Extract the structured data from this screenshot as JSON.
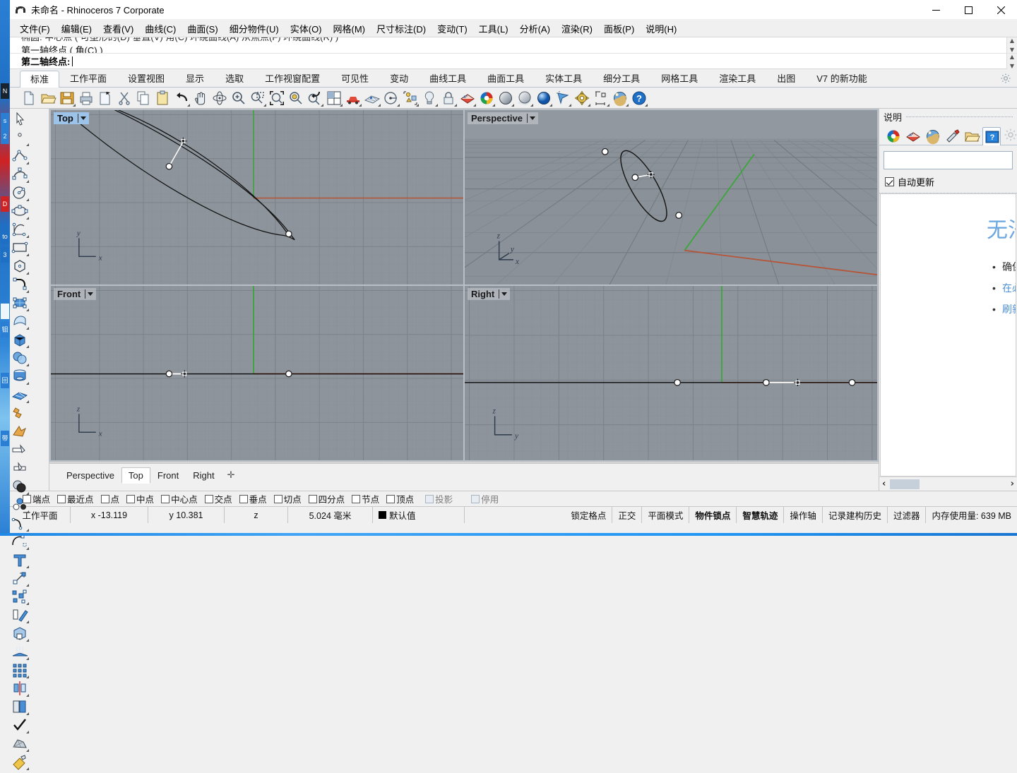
{
  "window": {
    "title": "未命名 - Rhinoceros 7 Corporate",
    "app_icon": "rhino-icon",
    "minimize_label": "—",
    "maximize_label": "☐",
    "close_label": "✕"
  },
  "menu": {
    "items": [
      {
        "label": "文件(F)"
      },
      {
        "label": "编辑(E)"
      },
      {
        "label": "查看(V)"
      },
      {
        "label": "曲线(C)"
      },
      {
        "label": "曲面(S)"
      },
      {
        "label": "细分物件(U)"
      },
      {
        "label": "实体(O)"
      },
      {
        "label": "网格(M)"
      },
      {
        "label": "尺寸标注(D)"
      },
      {
        "label": "变动(T)"
      },
      {
        "label": "工具(L)"
      },
      {
        "label": "分析(A)"
      },
      {
        "label": "渲染(R)"
      },
      {
        "label": "面板(P)"
      },
      {
        "label": "说明(H)"
      }
    ]
  },
  "command": {
    "history_line_cut": "椭圆: 中心点 ( 可塑形的(D) 垂直(V) 角(C) 环绕曲线(A) 从焦点(F) 环绕曲线(R) )",
    "history_line": "第一轴终点 ( 角(C) )",
    "prompt": "第二轴终点:",
    "input_value": ""
  },
  "toolbar_tabs": {
    "items": [
      {
        "label": "标准",
        "active": true
      },
      {
        "label": "工作平面",
        "active": false
      },
      {
        "label": "设置视图",
        "active": false
      },
      {
        "label": "显示",
        "active": false
      },
      {
        "label": "选取",
        "active": false
      },
      {
        "label": "工作视窗配置",
        "active": false
      },
      {
        "label": "可见性",
        "active": false
      },
      {
        "label": "变动",
        "active": false
      },
      {
        "label": "曲线工具",
        "active": false
      },
      {
        "label": "曲面工具",
        "active": false
      },
      {
        "label": "实体工具",
        "active": false
      },
      {
        "label": "细分工具",
        "active": false
      },
      {
        "label": "网格工具",
        "active": false
      },
      {
        "label": "渲染工具",
        "active": false
      },
      {
        "label": "出图",
        "active": false
      },
      {
        "label": "V7 的新功能",
        "active": false
      }
    ],
    "settings_icon": "gear-icon"
  },
  "main_toolbar": {
    "icons": [
      {
        "name": "new-file-icon",
        "flyout": false
      },
      {
        "name": "open-file-icon",
        "flyout": false
      },
      {
        "name": "save-file-icon",
        "flyout": true
      },
      {
        "name": "print-icon",
        "flyout": false
      },
      {
        "name": "export-icon",
        "flyout": false
      },
      {
        "name": "cut-icon",
        "flyout": false
      },
      {
        "name": "copy-icon",
        "flyout": false
      },
      {
        "name": "paste-icon",
        "flyout": false
      },
      {
        "name": "undo-icon",
        "flyout": true
      },
      {
        "name": "pan-icon",
        "flyout": false
      },
      {
        "name": "rotate-view-icon",
        "flyout": false
      },
      {
        "name": "zoom-in-icon",
        "flyout": false
      },
      {
        "name": "zoom-window-icon",
        "flyout": true
      },
      {
        "name": "zoom-extents-icon",
        "flyout": false
      },
      {
        "name": "zoom-selected-icon",
        "flyout": false
      },
      {
        "name": "zoom-previous-icon",
        "flyout": true
      },
      {
        "name": "viewport-layout-icon",
        "flyout": true
      },
      {
        "name": "render-preview-icon",
        "flyout": true
      },
      {
        "name": "grid-snap-icon",
        "flyout": true
      },
      {
        "name": "planar-icon",
        "flyout": true
      },
      {
        "name": "osnap-icon",
        "flyout": true
      },
      {
        "name": "light-icon",
        "flyout": true
      },
      {
        "name": "lock-icon",
        "flyout": true
      },
      {
        "name": "layer-icon",
        "flyout": true
      },
      {
        "name": "color-wheel-icon",
        "flyout": true
      },
      {
        "name": "shaded-view-icon",
        "flyout": true
      },
      {
        "name": "ghosted-view-icon",
        "flyout": true
      },
      {
        "name": "rendered-view-icon",
        "flyout": true
      },
      {
        "name": "select-filter-icon",
        "flyout": true
      },
      {
        "name": "options-gear-icon",
        "flyout": true
      },
      {
        "name": "dimension-icon",
        "flyout": true
      },
      {
        "name": "environment-icon",
        "flyout": true
      },
      {
        "name": "help-icon",
        "flyout": true
      }
    ]
  },
  "left_toolbar": {
    "icons": [
      {
        "name": "select-arrow-icon"
      },
      {
        "name": "point-icon"
      },
      {
        "name": "polyline-icon"
      },
      {
        "name": "control-point-curve-icon"
      },
      {
        "name": "circle-icon"
      },
      {
        "name": "ellipse-icon"
      },
      {
        "name": "arc-icon"
      },
      {
        "name": "rectangle-icon"
      },
      {
        "name": "polygon-icon"
      },
      {
        "name": "fillet-curve-icon"
      },
      {
        "name": "surface-from-points-icon"
      },
      {
        "name": "loft-surface-icon"
      },
      {
        "name": "box-icon"
      },
      {
        "name": "sphere-boolean-icon"
      },
      {
        "name": "cylinder-icon"
      },
      {
        "name": "surface-array-icon"
      },
      {
        "name": "explode-icon"
      },
      {
        "name": "join-icon"
      },
      {
        "name": "trim-icon"
      },
      {
        "name": "split-icon"
      },
      {
        "name": "boolean-union-icon"
      },
      {
        "name": "boolean-difference-icon"
      },
      {
        "name": "offset-curve-icon"
      },
      {
        "name": "blend-curve-icon"
      },
      {
        "name": "text-icon"
      },
      {
        "name": "point-transform-icon"
      },
      {
        "name": "scatter-copy-icon"
      },
      {
        "name": "move-icon"
      },
      {
        "name": "cube-boolean-icon"
      },
      {
        "name": "extrude-icon"
      },
      {
        "name": "array-icon"
      },
      {
        "name": "mirror-icon"
      },
      {
        "name": "properties-icon"
      },
      {
        "name": "check-icon"
      },
      {
        "name": "mesh-icon"
      },
      {
        "name": "render-paint-icon"
      }
    ]
  },
  "viewports": [
    {
      "name": "Top",
      "active": true,
      "axis_labels": [
        "y",
        "x"
      ]
    },
    {
      "name": "Perspective",
      "active": false,
      "axis_labels": [
        "z",
        "y",
        "x"
      ]
    },
    {
      "name": "Front",
      "active": false,
      "axis_labels": [
        "z",
        "x"
      ]
    },
    {
      "name": "Right",
      "active": false,
      "axis_labels": [
        "z",
        "y"
      ]
    }
  ],
  "viewport_tabs": {
    "items": [
      {
        "label": "Perspective",
        "active": false
      },
      {
        "label": "Top",
        "active": true
      },
      {
        "label": "Front",
        "active": false
      },
      {
        "label": "Right",
        "active": false
      }
    ],
    "add_label": "✛"
  },
  "right_panel": {
    "title": "说明",
    "tabs": [
      {
        "name": "layers-color-icon",
        "active": false
      },
      {
        "name": "materials-icon",
        "active": false
      },
      {
        "name": "environment-icon",
        "active": false
      },
      {
        "name": "ground-plane-icon",
        "active": false
      },
      {
        "name": "folder-icon",
        "active": false
      },
      {
        "name": "help-panel-icon",
        "active": true
      }
    ],
    "settings_icon": "gear-icon",
    "search_value": "",
    "search_placeholder": "",
    "autoupdate_label": "自动更新",
    "doc_heading": "无法显示说明内容",
    "doc_items": [
      {
        "text": "确保您的计算机已连接至网络。",
        "style": "dark"
      },
      {
        "text": "在必要时请检查防火墙设置。",
        "style": "link"
      },
      {
        "text": "刷新此页面重新载入内容。",
        "style": "link"
      }
    ],
    "scroll_left": "‹",
    "scroll_right": "›"
  },
  "osnap_bar": {
    "items": [
      {
        "label": "端点",
        "checked": false,
        "dim": false
      },
      {
        "label": "最近点",
        "checked": false,
        "dim": false
      },
      {
        "label": "点",
        "checked": false,
        "dim": false
      },
      {
        "label": "中点",
        "checked": false,
        "dim": false
      },
      {
        "label": "中心点",
        "checked": false,
        "dim": false
      },
      {
        "label": "交点",
        "checked": false,
        "dim": false
      },
      {
        "label": "垂点",
        "checked": false,
        "dim": false
      },
      {
        "label": "切点",
        "checked": false,
        "dim": false
      },
      {
        "label": "四分点",
        "checked": false,
        "dim": false
      },
      {
        "label": "节点",
        "checked": false,
        "dim": false
      },
      {
        "label": "顶点",
        "checked": false,
        "dim": false
      },
      {
        "label": "投影",
        "checked": false,
        "dim": true
      },
      {
        "label": "停用",
        "checked": false,
        "dim": true
      }
    ]
  },
  "status_bar": {
    "cplane_label": "工作平面",
    "x_label": "x -13.119",
    "y_label": "y 10.381",
    "z_label": "z",
    "units_label": "5.024 毫米",
    "layer_label": "默认值",
    "layer_color": "#000000",
    "toggles": [
      {
        "label": "锁定格点",
        "bold": false
      },
      {
        "label": "正交",
        "bold": false
      },
      {
        "label": "平面模式",
        "bold": false
      },
      {
        "label": "物件锁点",
        "bold": true
      },
      {
        "label": "智慧轨迹",
        "bold": true
      },
      {
        "label": "操作轴",
        "bold": false
      },
      {
        "label": "记录建构历史",
        "bold": false
      },
      {
        "label": "过滤器",
        "bold": false
      }
    ],
    "memory_label": "内存使用量: 639 MB"
  },
  "colors": {
    "viewport_bg": "#8e949c",
    "grid_line": "#848b93",
    "grid_major": "#747b84",
    "axis_x": "#b5553a",
    "axis_y": "#3ba63b",
    "curve": "#111111",
    "accent_blue": "#4a8fd6",
    "tab_active_bg": "#ffffff"
  }
}
